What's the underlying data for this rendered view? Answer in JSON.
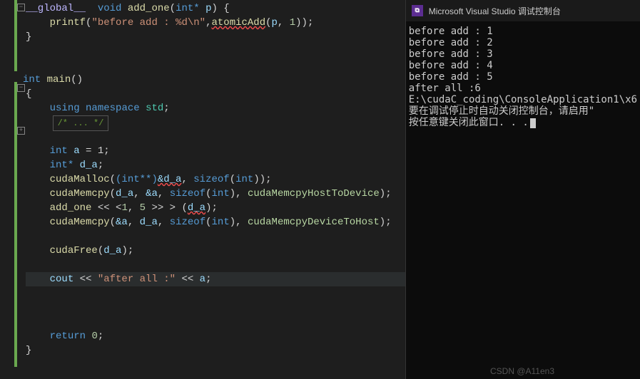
{
  "editor": {
    "fold_minus": "−",
    "fold_plus": "+",
    "tokens": {
      "global": "__global__",
      "void": "void",
      "add_one": "add_one",
      "int": "int",
      "intstar": "int*",
      "p": "p",
      "printf": "printf",
      "str1": "\"before add : %d\\n\"",
      "atomicAdd": "atomicAdd",
      "one": "1",
      "main": "main",
      "using": "using",
      "namespace": "namespace",
      "std": "std",
      "collapsed": "/* ... */",
      "a": "a",
      "eq1": " = 1",
      "d_a": "d_a",
      "cudaMalloc": "cudaMalloc",
      "intss": "(int**)",
      "amp_d_a": "&d_a",
      "sizeof": "sizeof",
      "cudaMemcpy": "cudaMemcpy",
      "amp_a": "&a",
      "h2d": "cudaMemcpyHostToDevice",
      "d2h": "cudaMemcpyDeviceToHost",
      "launch": "add_one << <1, 5 >> > (d_a)",
      "cudaFree": "cudaFree",
      "cout": "cout",
      "ltlt": " << ",
      "str2": "\"after all :\"",
      "return": "return",
      "zero": "0"
    }
  },
  "console": {
    "title": "Microsoft Visual Studio 调试控制台",
    "lines": [
      "before add : 1",
      "before add : 2",
      "before add : 3",
      "before add : 4",
      "before add : 5",
      "after all :6",
      "E:\\cudaC_coding\\ConsoleApplication1\\x6",
      "要在调试停止时自动关闭控制台，请启用\"",
      "按任意键关闭此窗口. . ."
    ],
    "icon_text": "⧉"
  },
  "watermark": "CSDN @A11en3"
}
